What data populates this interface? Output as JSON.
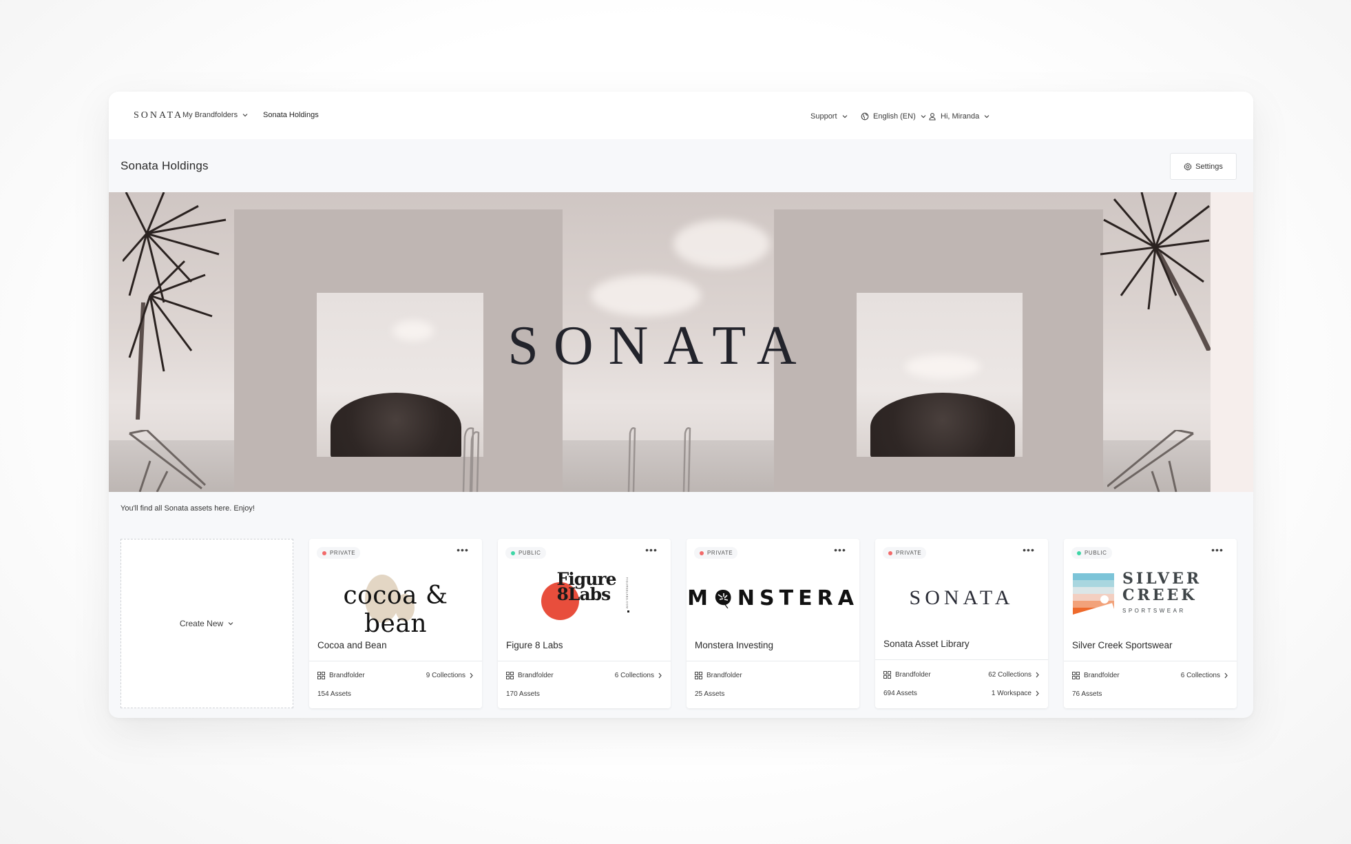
{
  "nav": {
    "brand": "SONATA",
    "my_brandfolders": "My Brandfolders",
    "current": "Sonata Holdings",
    "support": "Support",
    "language": "English (EN)",
    "user": "Hi, Miranda"
  },
  "header": {
    "title": "Sonata Holdings",
    "settings_label": "Settings"
  },
  "banner": {
    "wordmark": "SONATA"
  },
  "description": "You'll find all Sonata assets here. Enjoy!",
  "create_new_label": "Create New",
  "colors": {
    "private_dot": "#f26a6a",
    "public_dot": "#3ed6a6",
    "figure_circle": "#e84e3c"
  },
  "cards": [
    {
      "visibility": "PRIVATE",
      "logo_text": "cocoa & bean",
      "name": "Cocoa and Bean",
      "type": "Brandfolder",
      "collections": "9 Collections",
      "assets": "154 Assets",
      "workspace": null
    },
    {
      "visibility": "PUBLIC",
      "logo_text_line1": "Figure",
      "logo_text_line2": "8Labs",
      "logo_side_text": "FIGURE8LABS.COM",
      "name": "Figure 8 Labs",
      "type": "Brandfolder",
      "collections": "6 Collections",
      "assets": "170 Assets",
      "workspace": null
    },
    {
      "visibility": "PRIVATE",
      "logo_text_first": "M",
      "logo_text_rest": "NSTERA",
      "name": "Monstera Investing",
      "type": "Brandfolder",
      "collections": null,
      "assets": "25 Assets",
      "workspace": null
    },
    {
      "visibility": "PRIVATE",
      "logo_text": "SONATA",
      "name": "Sonata Asset Library",
      "type": "Brandfolder",
      "collections": "62 Collections",
      "assets": "694 Assets",
      "workspace": "1 Workspace"
    },
    {
      "visibility": "PUBLIC",
      "logo_text_line1": "SILVER",
      "logo_text_line2": "CREEK",
      "logo_sub": "SPORTSWEAR",
      "name": "Silver Creek Sportswear",
      "type": "Brandfolder",
      "collections": "6 Collections",
      "assets": "76 Assets",
      "workspace": null
    }
  ]
}
